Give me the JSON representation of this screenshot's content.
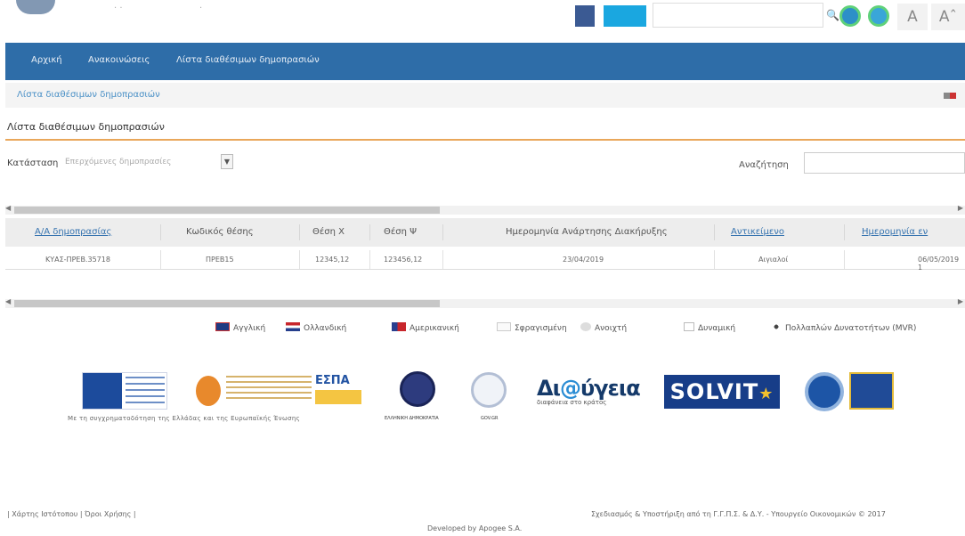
{
  "header": {
    "logo_text": "· ·",
    "logo_mark": "·",
    "search_placeholder": "",
    "font_size_small": "A",
    "font_size_large": "Aˆ"
  },
  "nav": {
    "items": [
      {
        "label": "Αρχική"
      },
      {
        "label": "Ανακοινώσεις"
      },
      {
        "label": "Λίστα διαθέσιμων δημοπρασιών"
      }
    ]
  },
  "breadcrumb": "Λίστα διαθέσιμων δημοπρασιών",
  "page": {
    "title": "Λίστα διαθέσιμων δημοπρασιών"
  },
  "filters": {
    "status_label": "Κατάσταση",
    "status_value": "Επερχόμενες δημοπρασίες",
    "search_label": "Αναζήτηση",
    "search_value": ""
  },
  "table": {
    "columns": [
      "Α/Α δημοπρασίας",
      "Κωδικός θέσης",
      "Θέση Χ",
      "Θέση Ψ",
      "Ημερομηνία Ανάρτησης Διακήρυξης",
      "Αντικείμενο",
      "Ημερομηνία εν"
    ],
    "rows": [
      [
        "ΚΥΑΣ-ΠΡΕΒ.35718",
        "ΠΡΕΒ15",
        "12345,12",
        "123456,12",
        "23/04/2019",
        "Αιγιαλοί",
        "06/05/2019 1"
      ]
    ]
  },
  "legend": [
    {
      "label": "Αγγλική"
    },
    {
      "label": "Ολλανδική"
    },
    {
      "label": "Αμερικανική"
    },
    {
      "label": "Σφραγισμένη"
    },
    {
      "label": "Ανοιχτή"
    },
    {
      "label": "Δυναμική"
    },
    {
      "label": "Πολλαπλών Δυνατοτήτων (MVR)"
    }
  ],
  "sponsors": {
    "eu_caption": "Με τη συγχρηματοδότηση της Ελλάδας και της Ευρωπαϊκής Ένωσης",
    "espa": "ΕΣΠΑ",
    "seal_caption": "ΕΛΛΗΝΙΚΗ ΔΗΜΟΚΡΑΤΙΑ",
    "seal2_caption": "GOV.GR",
    "diavgeia_prefix": "Δι",
    "diavgeia_at": "@",
    "diavgeia_suffix": "ύγεια",
    "diavgeia_tagline": "διαφάνεια στο κράτος",
    "solvit": "SOLVIT"
  },
  "footer": {
    "left": "| Χάρτης Ιστότοπου | Όροι Χρήσης |",
    "right": "Σχεδιασμός & Υποστήριξη από τη Γ.Γ.Π.Σ. & Δ.Υ. - Υπουργείο Οικονομικών © 2017",
    "developed": "Developed by Apogee S.A."
  }
}
